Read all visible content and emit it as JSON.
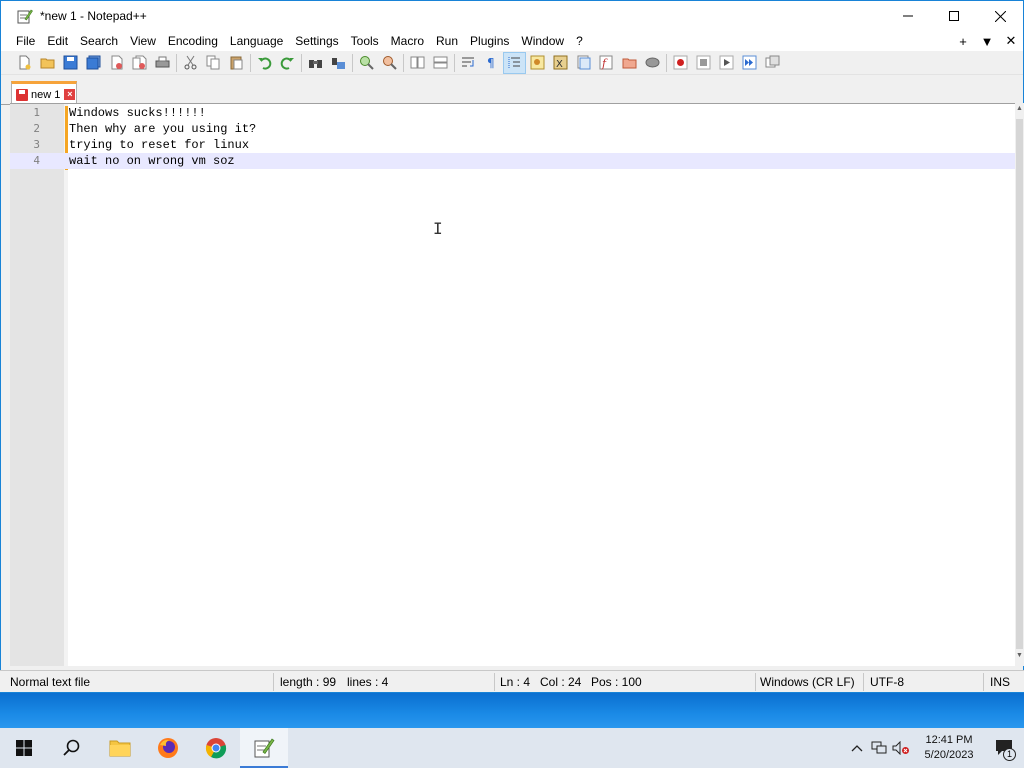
{
  "window": {
    "title": "*new 1 - Notepad++",
    "minimize_glyph": "—",
    "maximize_glyph": "☐",
    "close_glyph": "✕"
  },
  "menu": {
    "items": [
      "File",
      "Edit",
      "Search",
      "View",
      "Encoding",
      "Language",
      "Settings",
      "Tools",
      "Macro",
      "Run",
      "Plugins",
      "Window",
      "?"
    ],
    "right": [
      "+",
      "▼",
      "✕"
    ]
  },
  "toolbar": {
    "icons": [
      "new-file",
      "open-file",
      "save",
      "save-all",
      "close",
      "close-all",
      "print",
      "cut",
      "copy",
      "paste",
      "undo",
      "redo",
      "find",
      "replace",
      "zoom-in",
      "zoom-out",
      "sync-vertical",
      "sync-horizontal",
      "word-wrap",
      "show-all-characters",
      "indent-guide",
      "user-defined-language",
      "document-map",
      "document-list",
      "function-list",
      "folder-as-workspace",
      "monitoring",
      "start-recording",
      "stop-recording",
      "playback",
      "run-macro-multiple",
      "save-macro"
    ]
  },
  "tab": {
    "label": "new 1",
    "close": "×"
  },
  "editor": {
    "lines": [
      {
        "num": "1",
        "text": "Windows sucks!!!!!!"
      },
      {
        "num": "2",
        "text": "Then why are you using it?"
      },
      {
        "num": "3",
        "text": "trying to reset for linux"
      },
      {
        "num": "4",
        "text": "wait no on wrong vm soz"
      }
    ],
    "current_line": 4,
    "ibeam": "I"
  },
  "status": {
    "file_type": "Normal text file",
    "length": "length : 99",
    "lines": "lines : 4",
    "ln": "Ln : 4",
    "col": "Col : 24",
    "pos": "Pos : 100",
    "eol": "Windows (CR LF)",
    "encoding": "UTF-8",
    "mode": "INS"
  },
  "taskbar": {
    "time": "12:41 PM",
    "date": "5/20/2023",
    "notification_count": "1"
  },
  "colors": {
    "accent": "#1883d7",
    "tab_highlight": "#f6a33a",
    "current_line": "#e8e8ff",
    "changed_marker": "#f5a623"
  }
}
